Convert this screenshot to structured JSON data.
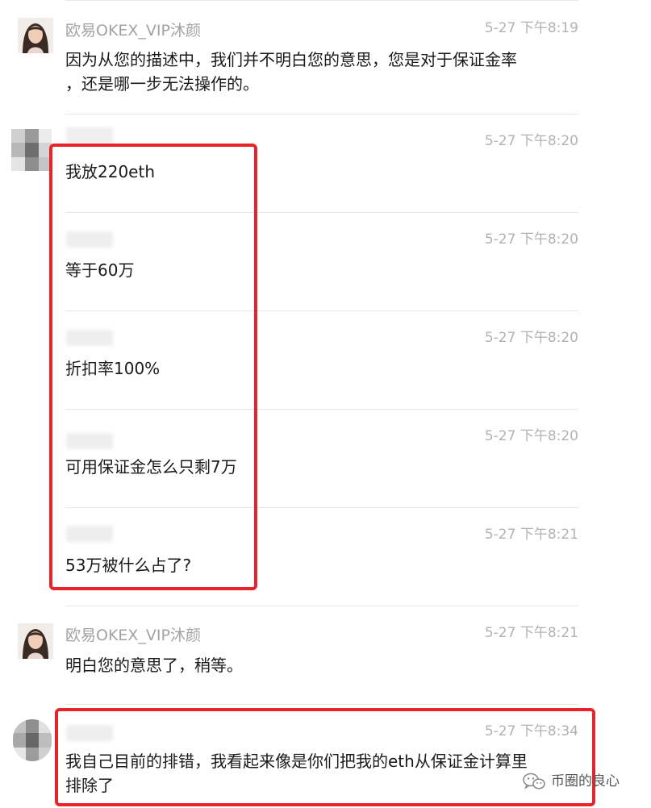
{
  "messages": [
    {
      "sender": "欧易OKEX_VIP沐颜",
      "time": "5-27 下午8:19",
      "text": "因为从您的描述中，我们并不明白您的意思，您是对于保证金率\n，还是哪一步无法操作的。"
    },
    {
      "sender": "",
      "time": "5-27 下午8:20",
      "text": "我放220eth"
    },
    {
      "sender": "",
      "time": "5-27 下午8:20",
      "text": "等于60万"
    },
    {
      "sender": "",
      "time": "5-27 下午8:20",
      "text": "折扣率100%"
    },
    {
      "sender": "",
      "time": "5-27 下午8:20",
      "text": "可用保证金怎么只剩7万"
    },
    {
      "sender": "",
      "time": "5-27 下午8:21",
      "text": "53万被什么占了?"
    },
    {
      "sender": "欧易OKEX_VIP沐颜",
      "time": "5-27 下午8:21",
      "text": "明白您的意思了，稍等。"
    },
    {
      "sender": "",
      "time": "5-27 下午8:34",
      "text": "我自己目前的排错，我看起来像是你们把我的eth从保证金计算里\n排除了"
    }
  ],
  "watermark": {
    "label": "币圈的良心",
    "icon": "wechat-icon"
  },
  "colors": {
    "highlight": "#e8242b",
    "sender": "#a2a2a2",
    "time": "#b2b2b2",
    "text": "#1a1a1a"
  }
}
